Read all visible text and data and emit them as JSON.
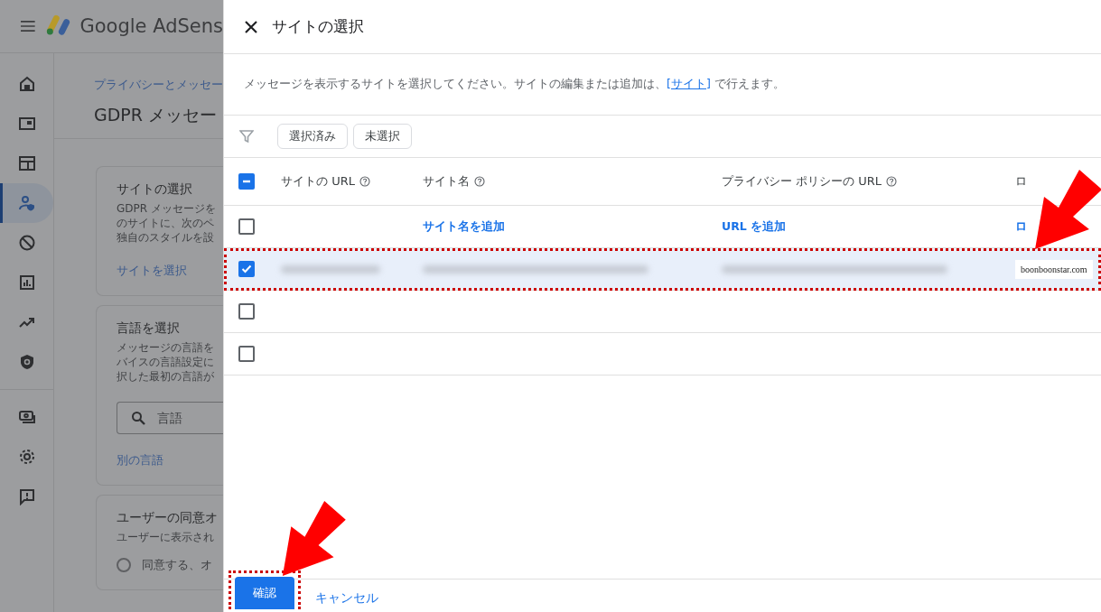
{
  "app": {
    "product_name": "Google AdSens"
  },
  "sidebar": {
    "items": [
      {
        "kind": "home",
        "selected": false
      },
      {
        "kind": "ad-unit",
        "selected": false
      },
      {
        "kind": "layout",
        "selected": false
      },
      {
        "kind": "privacy",
        "selected": true
      },
      {
        "kind": "block",
        "selected": false
      },
      {
        "kind": "report",
        "selected": false
      },
      {
        "kind": "trend",
        "selected": false
      },
      {
        "kind": "shield",
        "selected": false
      },
      {
        "kind": "payment",
        "selected": false
      },
      {
        "kind": "settings",
        "selected": false
      },
      {
        "kind": "feedback",
        "selected": false
      }
    ]
  },
  "page": {
    "breadcrumb": "プライバシーとメッセー",
    "title": "GDPR メッセー",
    "cards": [
      {
        "title": "サイトの選択",
        "lines": [
          "GDPR メッセージを",
          "のサイトに、次のペ",
          "独自のスタイルを設"
        ],
        "link": "サイトを選択"
      },
      {
        "title": "言語を選択",
        "lines": [
          "メッセージの言語を",
          "バイスの言語設定に",
          "択した最初の言語が"
        ],
        "search_placeholder": "言語",
        "link": "別の言語"
      },
      {
        "title": "ユーザーの同意オ",
        "lines": [
          "ユーザーに表示され"
        ],
        "option": "同意する、オ",
        "option_selected": false
      }
    ]
  },
  "dialog": {
    "title": "サイトの選択",
    "description": {
      "text": "メッセージを表示するサイトを選択してください。サイトの編集または追加は、",
      "link": "[サイト]",
      "suffix": " で行えます。"
    },
    "filters": [
      {
        "label": "選択済み",
        "selected": false
      },
      {
        "label": "未選択",
        "selected": false
      }
    ],
    "table": {
      "header_indeterminate": true,
      "columns": [
        "サイトの URL",
        "サイト名",
        "プライバシー ポリシーの URL",
        "ロ"
      ],
      "rows": [
        {
          "checked": false,
          "cells": [
            {
              "kind": "empty"
            },
            {
              "kind": "link",
              "text": "サイト名を追加"
            },
            {
              "kind": "link",
              "text": "URL を追加"
            },
            {
              "kind": "link",
              "text": "ロ"
            }
          ]
        },
        {
          "checked": true,
          "cells": [
            {
              "kind": "blurred"
            },
            {
              "kind": "blurred"
            },
            {
              "kind": "blurred"
            },
            {
              "kind": "logo",
              "text": "boonboonstar.com"
            }
          ]
        },
        {
          "checked": false,
          "cells": [
            {
              "kind": "empty"
            },
            {
              "kind": "empty"
            },
            {
              "kind": "empty"
            },
            {
              "kind": "empty"
            }
          ]
        },
        {
          "checked": false,
          "cells": [
            {
              "kind": "empty"
            },
            {
              "kind": "empty"
            },
            {
              "kind": "empty"
            },
            {
              "kind": "empty"
            }
          ]
        }
      ]
    },
    "buttons": [
      {
        "label": "確認",
        "kind": "primary"
      },
      {
        "label": "キャンセル",
        "kind": "text"
      }
    ]
  }
}
